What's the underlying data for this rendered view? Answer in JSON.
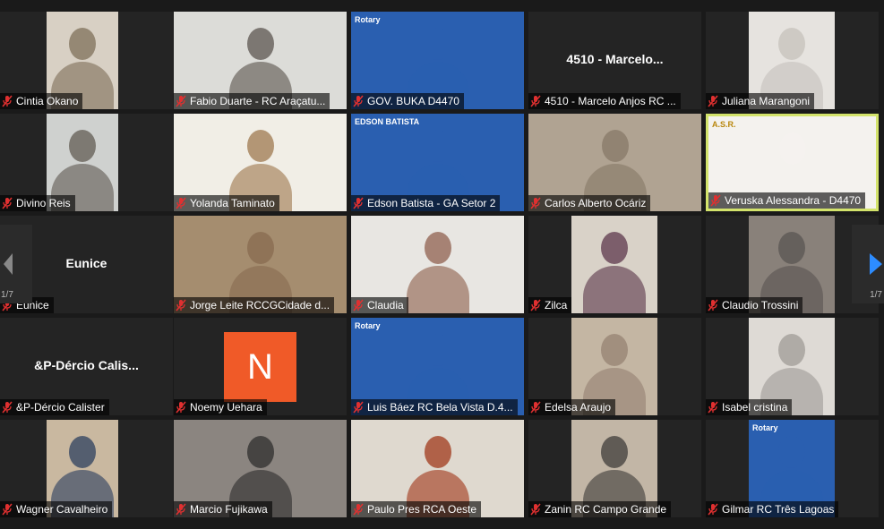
{
  "colors": {
    "bg": "#1a1a1a",
    "tile": "#242424",
    "active_border": "#d3e36b",
    "muted_mic": "#e03030",
    "nav_arrow": "#2d8cff"
  },
  "participants": [
    {
      "label": "Cintia Okano",
      "video": "#8a7b66",
      "video_bg": "#d8d0c4",
      "icon": "mic-muted-icon"
    },
    {
      "label": "Fabio Duarte - RC Araçatu...",
      "video": "#6b6560",
      "video_bg": "#dcdcd8",
      "icon": "mic-muted-icon"
    },
    {
      "label": "GOV. BUKA D4470",
      "video": "#2a5fb0",
      "video_bg": "#2a5fb0",
      "icon": "mic-muted-icon",
      "card": "Rotary"
    },
    {
      "label": "4510 - Marcelo Anjos RC ...",
      "name_card": "4510 - Marcelo...",
      "icon": "mic-muted-icon"
    },
    {
      "label": "Juliana Marangoni",
      "video": "#c9c5c0",
      "video_bg": "#e6e3df",
      "icon": "mic-muted-icon"
    },
    {
      "label": "Divino Reis",
      "video": "#6e6a62",
      "video_bg": "#cfd1cf",
      "icon": "mic-muted-icon"
    },
    {
      "label": "Yolanda Taminato",
      "video": "#a88660",
      "video_bg": "#f1eee6",
      "icon": "mic-muted-icon"
    },
    {
      "label": "Edson Batista - GA Setor 2",
      "video": "#2a5fb0",
      "video_bg": "#2a5fb0",
      "icon": "mic-muted-icon",
      "card": "EDSON BATISTA"
    },
    {
      "label": "Carlos Alberto Ocáriz",
      "video": "#8c7e6c",
      "video_bg": "#b0a392",
      "icon": "mic-muted-icon"
    },
    {
      "label": "Veruska Alessandra - D4470",
      "video": "#f4f2ee",
      "video_bg": "#f4f2ee",
      "icon": "mic-muted-icon",
      "active": true,
      "card": "A.S.R."
    },
    {
      "label": "Eunice",
      "name_card": "Eunice",
      "icon": "mic-muted-icon"
    },
    {
      "label": "Jorge Leite RCCGCidade d...",
      "video": "#8b6f54",
      "video_bg": "#a58d6f",
      "icon": "mic-muted-icon"
    },
    {
      "label": "Claudia",
      "video": "#9a7060",
      "video_bg": "#e8e6e2",
      "icon": "mic-muted-icon"
    },
    {
      "label": "Zilca",
      "video": "#6b4a5a",
      "video_bg": "#d9d2c8",
      "icon": "mic-muted-icon"
    },
    {
      "label": "Claudio Trossini",
      "video": "#5f5a57",
      "video_bg": "#89817a",
      "icon": "mic-muted-icon"
    },
    {
      "label": "&P-Dércio Calister",
      "name_card": "&P-Dércio Calis...",
      "icon": "mic-muted-icon"
    },
    {
      "label": "Noemy Uehara",
      "avatar_letter": "N",
      "icon": "mic-muted-icon"
    },
    {
      "label": "Luis Báez RC Bela Vista D.4...",
      "video": "#2a5fb0",
      "video_bg": "#2a5fb0",
      "icon": "mic-muted-icon",
      "card": "Rotary"
    },
    {
      "label": "Edelsa Araujo",
      "video": "#9b8878",
      "video_bg": "#c4b6a3",
      "icon": "mic-muted-icon"
    },
    {
      "label": "Isabel cristina",
      "video": "#a7a29e",
      "video_bg": "#dedad5",
      "icon": "mic-muted-icon"
    },
    {
      "label": "Wagner Cavalheiro",
      "video": "#3f4d66",
      "video_bg": "#c9b8a0",
      "icon": "mic-muted-icon"
    },
    {
      "label": "Marcio Fujikawa",
      "video": "#3a3837",
      "video_bg": "#8b8580",
      "icon": "mic-muted-icon"
    },
    {
      "label": "Paulo Pres RCA Oeste",
      "video": "#a84b30",
      "video_bg": "#dfd9cf",
      "icon": "mic-muted-icon"
    },
    {
      "label": "Zanin RC Campo Grande",
      "video": "#4f4b47",
      "video_bg": "#c2b6a6",
      "icon": "mic-muted-icon"
    },
    {
      "label": "Gilmar RC Três Lagoas",
      "video": "#2a5fb0",
      "video_bg": "#2a5fb0",
      "icon": "mic-muted-icon",
      "card": "Rotary"
    }
  ],
  "pager": {
    "left_page": "1/7",
    "right_page": "1/7"
  }
}
